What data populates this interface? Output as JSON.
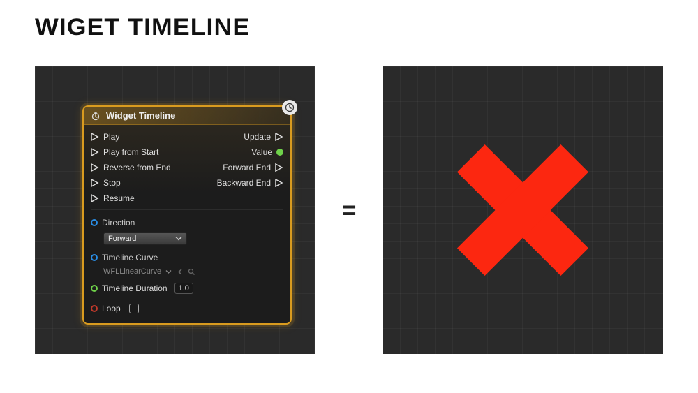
{
  "page_title": "WIGET TIMELINE",
  "node": {
    "title": "Widget Timeline",
    "pins": {
      "play": "Play",
      "play_from_start": "Play from Start",
      "reverse_from_end": "Reverse from End",
      "stop": "Stop",
      "resume": "Resume",
      "update": "Update",
      "value": "Value",
      "forward_end": "Forward End",
      "backward_end": "Backward End"
    },
    "direction": {
      "label": "Direction",
      "selected": "Forward"
    },
    "curve": {
      "label": "Timeline Curve",
      "asset_name": "WFLLinearCurve"
    },
    "duration": {
      "label": "Timeline Duration",
      "value": "1.0"
    },
    "loop_label": "Loop"
  },
  "equals_symbol": "="
}
